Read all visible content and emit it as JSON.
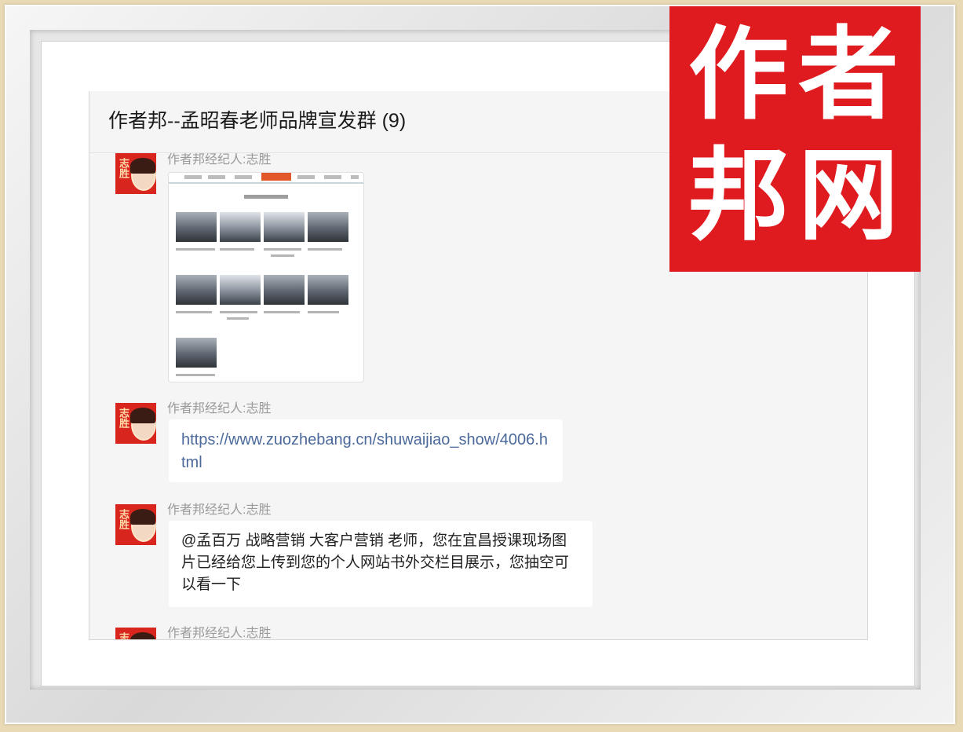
{
  "chat": {
    "title": "作者邦--孟昭春老师品牌宣发群 (9)"
  },
  "messages": [
    {
      "sender": "作者邦经纪人:志胜",
      "type": "image"
    },
    {
      "sender": "作者邦经纪人:志胜",
      "type": "link",
      "text": "https://www.zuozhebang.cn/shuwaijiao_show/4006.html"
    },
    {
      "sender": "作者邦经纪人:志胜",
      "type": "text",
      "text": "@孟百万 战略营销 大客户营销 老师，您在宜昌授课现场图片已经给您上传到您的个人网站书外交栏目展示，您抽空可以看一下"
    },
    {
      "sender": "作者邦经纪人:志胜",
      "type": "partial"
    }
  ],
  "avatar": {
    "chars": "志胜"
  },
  "logo": {
    "line1_a": "作",
    "line1_b": "者",
    "line2_a": "邦",
    "line2_b": "网"
  },
  "colors": {
    "logo_red": "#e01b20",
    "link_blue": "#4b6a9b",
    "active_nav": "#e2582a"
  }
}
